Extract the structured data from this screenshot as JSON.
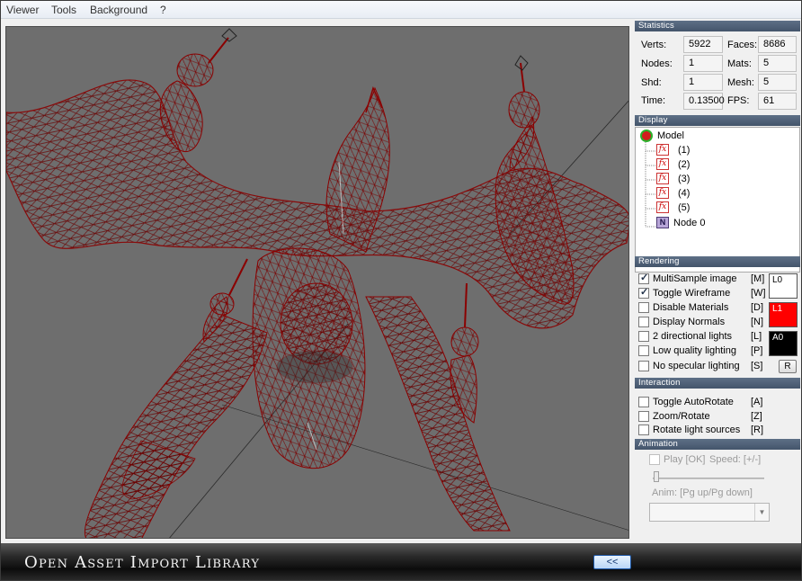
{
  "menu": {
    "items": [
      "Viewer",
      "Tools",
      "Background",
      "?"
    ]
  },
  "statistics": {
    "header": "Statistics",
    "verts_label": "Verts:",
    "verts_value": "5922",
    "faces_label": "Faces:",
    "faces_value": "8686",
    "nodes_label": "Nodes:",
    "nodes_value": "1",
    "mats_label": "Mats:",
    "mats_value": "5",
    "shd_label": "Shd:",
    "shd_value": "1",
    "mesh_label": "Mesh:",
    "mesh_value": "5",
    "time_label": "Time:",
    "time_value": "0.13500",
    "fps_label": "FPS:",
    "fps_value": "61"
  },
  "display": {
    "header": "Display",
    "root": "Model",
    "materials": [
      "(1)",
      "(2)",
      "(3)",
      "(4)",
      "(5)"
    ],
    "material_icon_label": "fx",
    "node_icon_label": "N",
    "node": "Node 0"
  },
  "rendering": {
    "header": "Rendering",
    "options": [
      {
        "label": "MultiSample image",
        "key": "[M]",
        "checked": true
      },
      {
        "label": "Toggle Wireframe",
        "key": "[W]",
        "checked": true
      },
      {
        "label": "Disable Materials",
        "key": "[D]",
        "checked": false
      },
      {
        "label": "Display Normals",
        "key": "[N]",
        "checked": false
      },
      {
        "label": "2 directional lights",
        "key": "[L]",
        "checked": false
      },
      {
        "label": "Low quality lighting",
        "key": "[P]",
        "checked": false
      },
      {
        "label": "No specular lighting",
        "key": "[S]",
        "checked": false
      }
    ],
    "swatches": [
      {
        "label": "L0",
        "color": "#ffffff",
        "text_color": "#000000"
      },
      {
        "label": "L1",
        "color": "#ff0000",
        "text_color": "#ffffff"
      },
      {
        "label": "A0",
        "color": "#000000",
        "text_color": "#ffffff"
      }
    ],
    "reset_label": "R"
  },
  "interaction": {
    "header": "Interaction",
    "options": [
      {
        "label": "Toggle AutoRotate",
        "key": "[A]",
        "checked": false
      },
      {
        "label": "Zoom/Rotate",
        "key": "[Z]",
        "checked": false
      },
      {
        "label": "Rotate light sources",
        "key": "[R]",
        "checked": false
      }
    ]
  },
  "animation": {
    "header": "Animation",
    "play_label": "Play [OK]",
    "speed_label": "Speed: [+/-]",
    "anim_label": "Anim: [Pg up/Pg down]",
    "combo_value": ""
  },
  "footer": {
    "title": "Open Asset Import Library",
    "collapse_label": "<<"
  },
  "colors": {
    "wire": "#8b0000",
    "viewport_bg": "#6e6e6e",
    "section_header": "#4f6078"
  }
}
